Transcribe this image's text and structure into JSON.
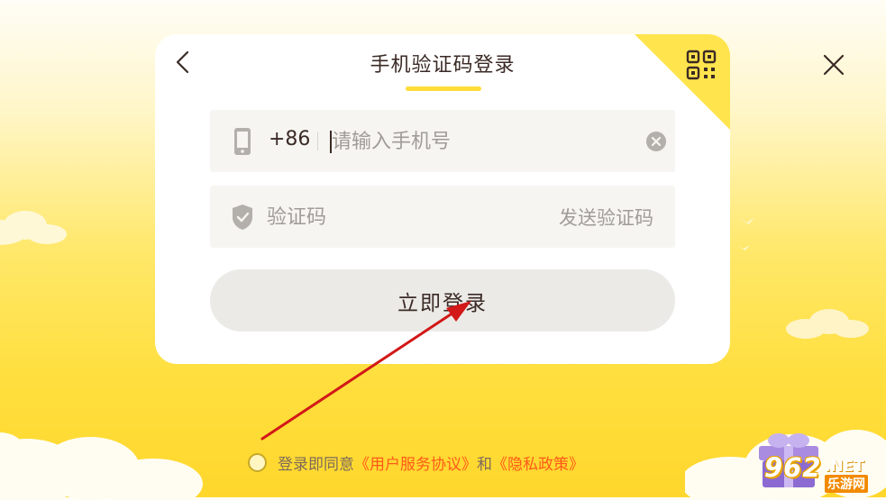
{
  "login": {
    "title": "手机验证码登录",
    "phone": {
      "country_code": "+86",
      "placeholder": "请输入手机号",
      "value": ""
    },
    "code": {
      "placeholder": "验证码",
      "value": "",
      "send_label": "发送验证码"
    },
    "submit_label": "立即登录"
  },
  "agreement": {
    "prefix": "登录即同意",
    "terms_link": "《用户服务协议》",
    "conjunction": "和",
    "privacy_link": "《隐私政策》",
    "checked": false
  },
  "watermark": {
    "number": "962",
    "suffix": ".NET",
    "subtitle": "乐游网"
  },
  "icons": {
    "back": "chevron-left-icon",
    "qr": "qr-code-icon",
    "close": "close-icon",
    "phone": "phone-icon",
    "shield": "shield-check-icon",
    "clear": "clear-circle-icon",
    "gift": "gift-box-icon"
  },
  "colors": {
    "accent": "#ffdc37",
    "link": "#ff5a19",
    "text": "#3b2a25",
    "placeholder": "#a09c97",
    "annotation_arrow": "#d21818"
  }
}
